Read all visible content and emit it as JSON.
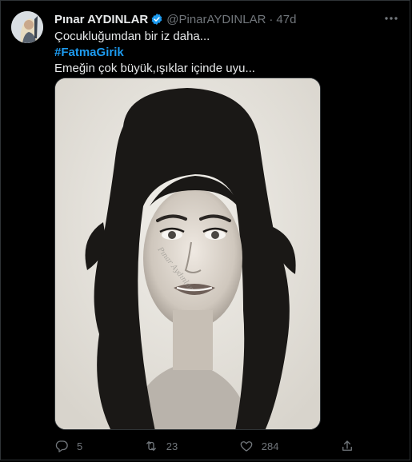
{
  "tweet": {
    "author": {
      "name": "Pınar AYDINLAR",
      "handle": "@PinarAYDINLAR",
      "separator": "·",
      "time": "47d"
    },
    "text": {
      "line1": "Çocukluğumdan bir iz daha...",
      "hashtag": "#FatmaGirik",
      "line3": "Emeğin çok büyük,ışıklar içinde uyu..."
    },
    "photo": {
      "watermark": "Pınar Aydınlar"
    },
    "actions": {
      "reply_count": "5",
      "retweet_count": "23",
      "like_count": "284"
    },
    "icons": [
      "verified-icon",
      "more-icon",
      "reply-icon",
      "retweet-icon",
      "like-icon",
      "share-icon"
    ],
    "colors": {
      "background": "#000000",
      "text": "#e7e9ea",
      "muted": "#71767b",
      "link": "#1d9bf0",
      "verified": "#1d9bf0"
    }
  }
}
